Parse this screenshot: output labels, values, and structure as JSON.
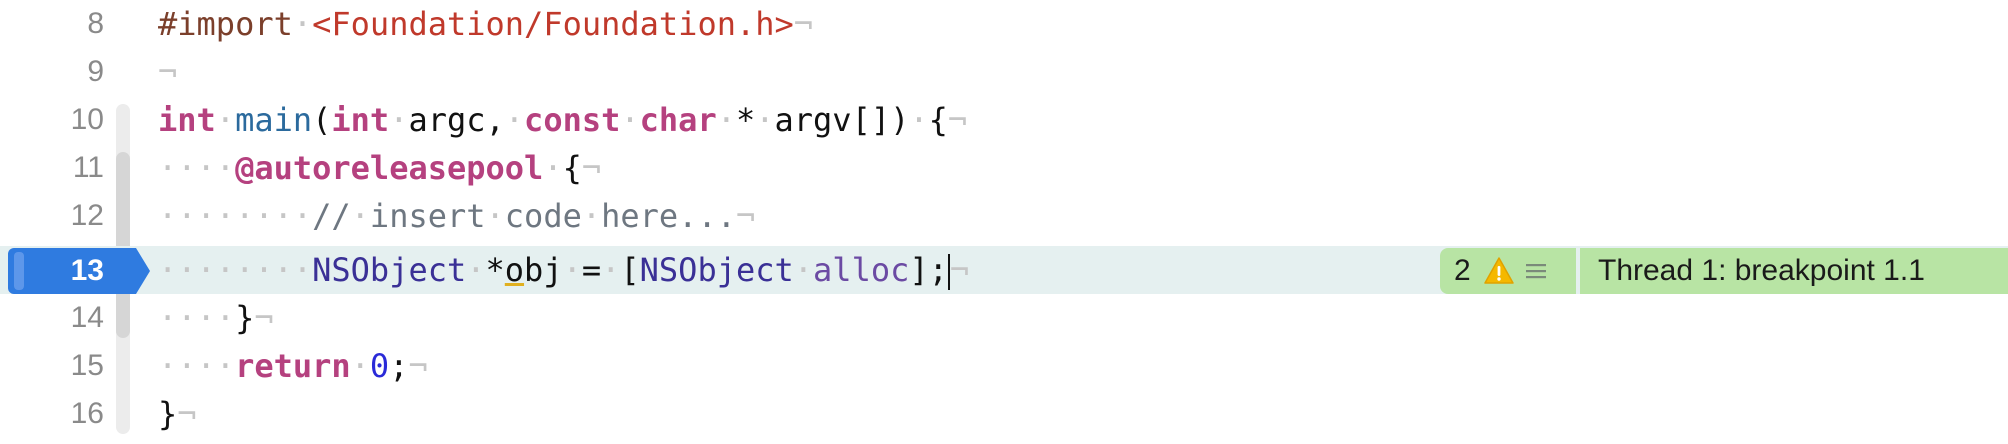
{
  "editor": {
    "current_line": "13",
    "lines": [
      {
        "number": "8"
      },
      {
        "number": "9"
      },
      {
        "number": "10"
      },
      {
        "number": "11"
      },
      {
        "number": "12"
      },
      {
        "number": "13"
      },
      {
        "number": "14"
      },
      {
        "number": "15"
      },
      {
        "number": "16"
      }
    ],
    "tokens": {
      "l8_directive": "#import",
      "l8_header": "<Foundation/Foundation.h>",
      "l10_int1": "int",
      "l10_main": "main",
      "l10_paren": "(",
      "l10_int2": "int",
      "l10_argc": "argc,",
      "l10_const": "const",
      "l10_char": "char",
      "l10_star": "*",
      "l10_argv": "argv[])",
      "l10_brace": "{",
      "l11_pool": "@autoreleasepool",
      "l11_brace": "{",
      "l12_comment_slashes": "//",
      "l12_comment_w1": "insert",
      "l12_comment_w2": "code",
      "l12_comment_w3": "here...",
      "l13_class1": "NSObject",
      "l13_star": "*",
      "l13_o": "o",
      "l13_bj": "bj",
      "l13_eq": "=",
      "l13_bracket": "[",
      "l13_class2": "NSObject",
      "l13_alloc": "alloc",
      "l13_end": "];",
      "l14_brace": "}",
      "l15_return": "return",
      "l15_zero": "0",
      "l15_semi": ";",
      "l16_brace": "}",
      "space_dot": "·",
      "eol": "¬"
    }
  },
  "issues": {
    "count": "2",
    "icons": [
      "warning-triangle-icon",
      "list-menu-icon"
    ]
  },
  "debugger": {
    "thread_banner": "Thread 1: breakpoint 1.1"
  },
  "colors": {
    "breakpoint": "#2f7be0",
    "current_line_bg": "#e5f0f0",
    "banner_bg": "#b8e4a4",
    "keyword": "#b5417f",
    "warning": "#f5b800"
  }
}
